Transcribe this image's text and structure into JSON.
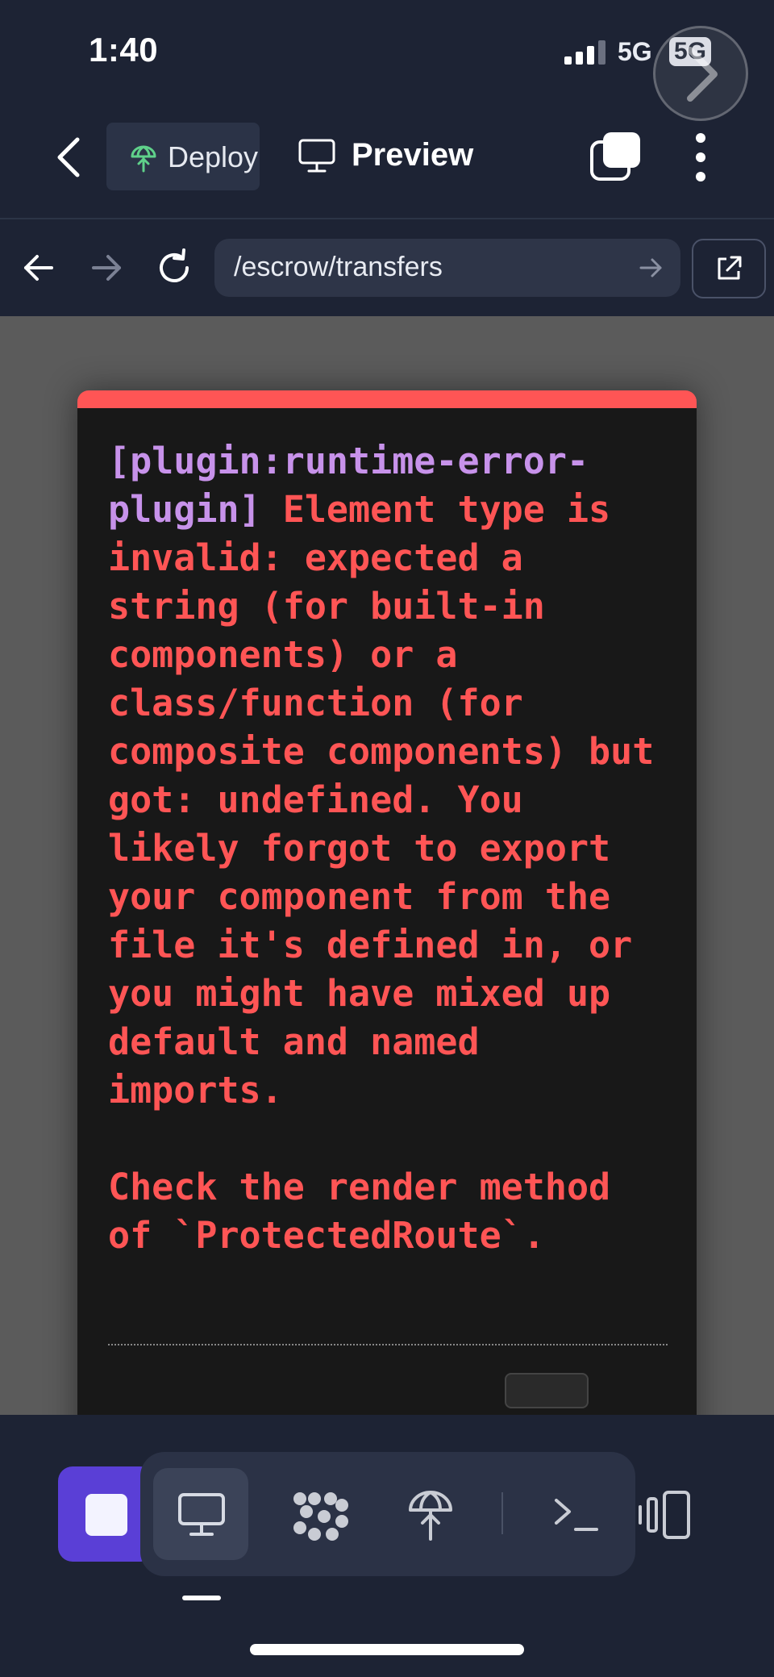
{
  "status_bar": {
    "time": "1:40",
    "network": "5G",
    "network_badge": "5G"
  },
  "nav": {
    "deploy_tab_label": "Deploy",
    "preview_tab_label": "Preview"
  },
  "browser": {
    "url": "/escrow/transfers"
  },
  "error": {
    "plugin": "[plugin:runtime-error-plugin]",
    "message": " Element type is invalid: expected a string (for built-in components) or a class/function (for composite components) but got: undefined. You likely forgot to export your component from the file it's defined in, or you might have mixed up default and named imports.\n\nCheck the render method of `ProtectedRoute`."
  },
  "colors": {
    "accent": "#5a3fd6",
    "error": "#ff5555",
    "plugin": "#c792ea",
    "background": "#1d2334"
  },
  "icons": {
    "back": "chevron-left-icon",
    "deploy": "deploy-globe-icon",
    "preview": "monitor-icon",
    "windows": "windows-icon",
    "more": "more-vertical-icon",
    "reload": "reload-icon",
    "external": "external-link-icon",
    "agent": "agent-icon",
    "shell": "shell-icon",
    "devices": "devices-icon"
  }
}
